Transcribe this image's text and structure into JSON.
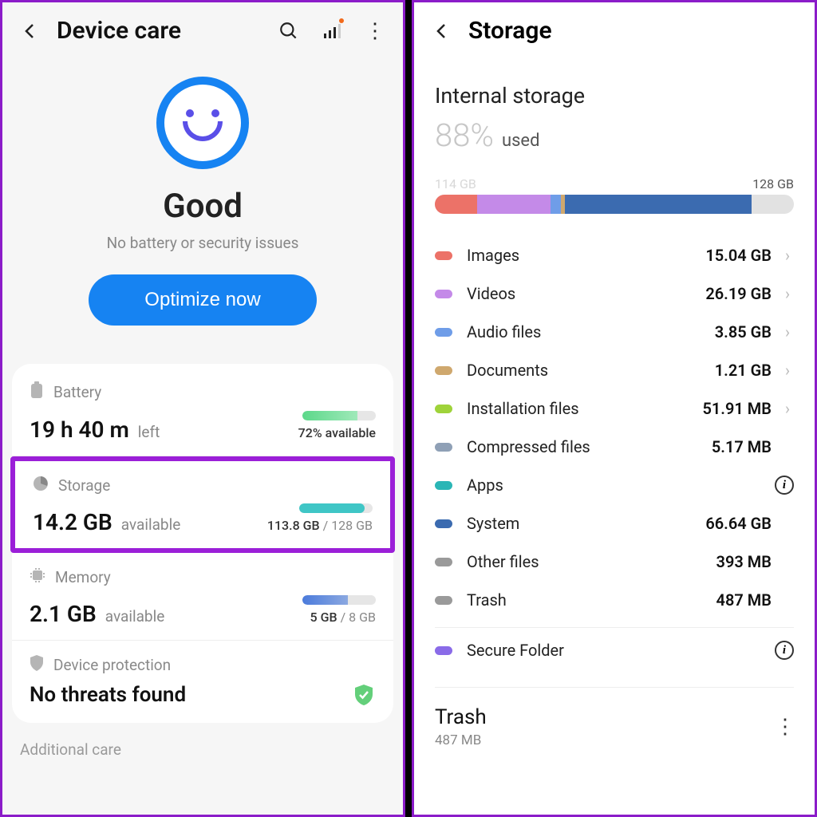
{
  "left": {
    "title": "Device care",
    "status": "Good",
    "subStatus": "No battery or security issues",
    "optimize": "Optimize now",
    "battery": {
      "label": "Battery",
      "value": "19 h 40 m",
      "unit": "left",
      "pct": "72% available"
    },
    "storage": {
      "label": "Storage",
      "value": "14.2 GB",
      "unit": "available",
      "used": "113.8 GB",
      "total": "128 GB"
    },
    "memory": {
      "label": "Memory",
      "value": "2.1 GB",
      "unit": "available",
      "used": "5 GB",
      "total": "8 GB"
    },
    "protection": {
      "label": "Device protection",
      "value": "No threats found"
    },
    "additional": "Additional care"
  },
  "right": {
    "title": "Storage",
    "internalTitle": "Internal storage",
    "pct": "88%",
    "usedLabel": "used",
    "barLeft": "114 GB",
    "barRight": "128 GB",
    "categories": [
      {
        "name": "Images",
        "size": "15.04 GB",
        "color": "#ec7268",
        "chevron": true
      },
      {
        "name": "Videos",
        "size": "26.19 GB",
        "color": "#c48ae8",
        "chevron": true
      },
      {
        "name": "Audio files",
        "size": "3.85 GB",
        "color": "#6f9de8",
        "chevron": true
      },
      {
        "name": "Documents",
        "size": "1.21 GB",
        "color": "#cfa86e",
        "chevron": true
      },
      {
        "name": "Installation files",
        "size": "51.91 MB",
        "color": "#9fd33a",
        "chevron": true
      },
      {
        "name": "Compressed files",
        "size": "5.17 MB",
        "color": "#8fa0b6",
        "chevron": false
      },
      {
        "name": "Apps",
        "size": "",
        "color": "#2bb6b6",
        "info": true
      },
      {
        "name": "System",
        "size": "66.64 GB",
        "color": "#3b6bb0",
        "chevron": false
      },
      {
        "name": "Other files",
        "size": "393 MB",
        "color": "#9a9a9a",
        "chevron": false
      },
      {
        "name": "Trash",
        "size": "487 MB",
        "color": "#9a9a9a",
        "chevron": false
      }
    ],
    "secureFolder": {
      "name": "Secure Folder",
      "color": "#8a6be8"
    },
    "trashSection": {
      "title": "Trash",
      "sub": "487 MB"
    }
  }
}
